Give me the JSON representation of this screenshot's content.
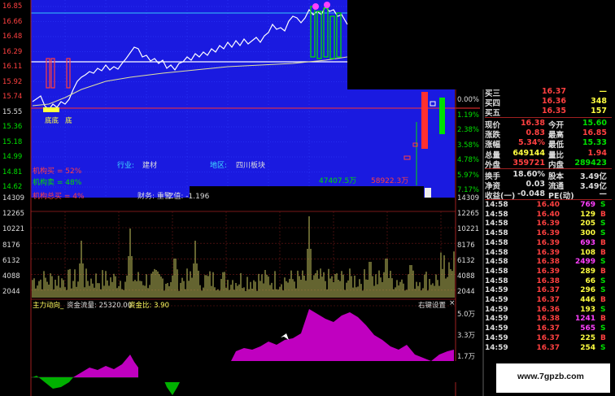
{
  "price_axis": {
    "left_ticks": [
      "16.85",
      "16.66",
      "16.48",
      "16.29",
      "16.11",
      "15.92",
      "15.74",
      "15.55",
      "15.36",
      "15.18",
      "14.99",
      "14.81",
      "14.62"
    ],
    "right_ticks": [
      "0.00%",
      "1.19%",
      "2.38%",
      "3.58%",
      "4.78%",
      "5.97%",
      "7.17%"
    ]
  },
  "volume_axis": {
    "ticks": [
      "14309",
      "12265",
      "10221",
      "8176",
      "6132",
      "4088",
      "2044"
    ]
  },
  "fund_axis": {
    "ticks": [
      "5.0万",
      "3.3万",
      "1.7万"
    ]
  },
  "info": {
    "industry_label": "行业:",
    "industry": "建材",
    "region_label": "地区:",
    "region": "四川板块",
    "buy_pct": "机构买 = 52%",
    "sell_pct": "机构卖 = 48%",
    "total_buy": "机构总买 = 4%",
    "finance": "财务: 重警",
    "zvalue": "-Z值: -1.196",
    "amount_green": "47407.5万",
    "amount_red": "58922.3万",
    "label_buy1": "底底",
    "label_buy2": "底"
  },
  "indicator": {
    "title": "主力动向_",
    "flow": "资金流量: 25320.00",
    "ratio": "资金比: 3.90",
    "settings": "右键设置",
    "close": "×"
  },
  "quote": {
    "bids": [
      {
        "label": "买三",
        "price": "16.37",
        "vol": "—"
      },
      {
        "label": "买四",
        "price": "16.36",
        "vol": "348"
      },
      {
        "label": "买五",
        "price": "16.35",
        "vol": "157"
      }
    ],
    "stats": [
      {
        "l1": "现价",
        "v1": "16.38",
        "l2": "今开",
        "v2": "15.60",
        "c1": "red",
        "c2": "green"
      },
      {
        "l1": "涨跌",
        "v1": "0.83",
        "l2": "最高",
        "v2": "16.85",
        "c1": "red",
        "c2": "red"
      },
      {
        "l1": "涨幅",
        "v1": "5.34%",
        "l2": "最低",
        "v2": "15.33",
        "c1": "red",
        "c2": "green"
      },
      {
        "l1": "总量",
        "v1": "649144",
        "l2": "量比",
        "v2": "1.94",
        "c1": "yellow",
        "c2": "red"
      },
      {
        "l1": "外盘",
        "v1": "359721",
        "l2": "内盘",
        "v2": "289423",
        "c1": "red",
        "c2": "green"
      }
    ],
    "stats2": [
      {
        "l1": "换手",
        "v1": "18.60%",
        "l2": "股本",
        "v2": "3.49亿"
      },
      {
        "l1": "净资",
        "v1": "0.03",
        "l2": "流通",
        "v2": "3.49亿"
      },
      {
        "l1": "收益(一)",
        "v1": "-0.048",
        "l2": "PE(动)",
        "v2": "—"
      }
    ],
    "ticks": [
      {
        "t": "14:58",
        "p": "16.40",
        "v": "769",
        "s": "S",
        "c": "red",
        "vc": "mag"
      },
      {
        "t": "14:58",
        "p": "16.40",
        "v": "129",
        "s": "B",
        "c": "red",
        "vc": "yellow"
      },
      {
        "t": "14:58",
        "p": "16.39",
        "v": "205",
        "s": "S",
        "c": "red",
        "vc": "yellow"
      },
      {
        "t": "14:58",
        "p": "16.39",
        "v": "300",
        "s": "S",
        "c": "red",
        "vc": "yellow"
      },
      {
        "t": "14:58",
        "p": "16.39",
        "v": "693",
        "s": "B",
        "c": "red",
        "vc": "mag"
      },
      {
        "t": "14:58",
        "p": "16.39",
        "v": "108",
        "s": "B",
        "c": "red",
        "vc": "yellow"
      },
      {
        "t": "14:58",
        "p": "16.38",
        "v": "2499",
        "s": "S",
        "c": "red",
        "vc": "mag"
      },
      {
        "t": "14:58",
        "p": "16.39",
        "v": "289",
        "s": "B",
        "c": "red",
        "vc": "yellow"
      },
      {
        "t": "14:58",
        "p": "16.38",
        "v": "66",
        "s": "S",
        "c": "red",
        "vc": "yellow"
      },
      {
        "t": "14:59",
        "p": "16.37",
        "v": "296",
        "s": "S",
        "c": "red",
        "vc": "yellow"
      },
      {
        "t": "14:59",
        "p": "16.37",
        "v": "446",
        "s": "B",
        "c": "red",
        "vc": "yellow"
      },
      {
        "t": "14:59",
        "p": "16.36",
        "v": "193",
        "s": "S",
        "c": "red",
        "vc": "yellow"
      },
      {
        "t": "14:59",
        "p": "16.38",
        "v": "1241",
        "s": "B",
        "c": "red",
        "vc": "mag"
      },
      {
        "t": "14:59",
        "p": "16.37",
        "v": "565",
        "s": "S",
        "c": "red",
        "vc": "mag"
      },
      {
        "t": "14:59",
        "p": "16.37",
        "v": "225",
        "s": "B",
        "c": "red",
        "vc": "yellow"
      },
      {
        "t": "14:59",
        "p": "16.37",
        "v": "254",
        "s": "S",
        "c": "red",
        "vc": "yellow"
      }
    ]
  },
  "watermark": "www.7gpzb.com",
  "colors": {
    "chart_bg": "#1818e0",
    "red": "#ff4040",
    "green": "#00e000",
    "yellow": "#ffff40",
    "magenta": "#c000c0"
  }
}
